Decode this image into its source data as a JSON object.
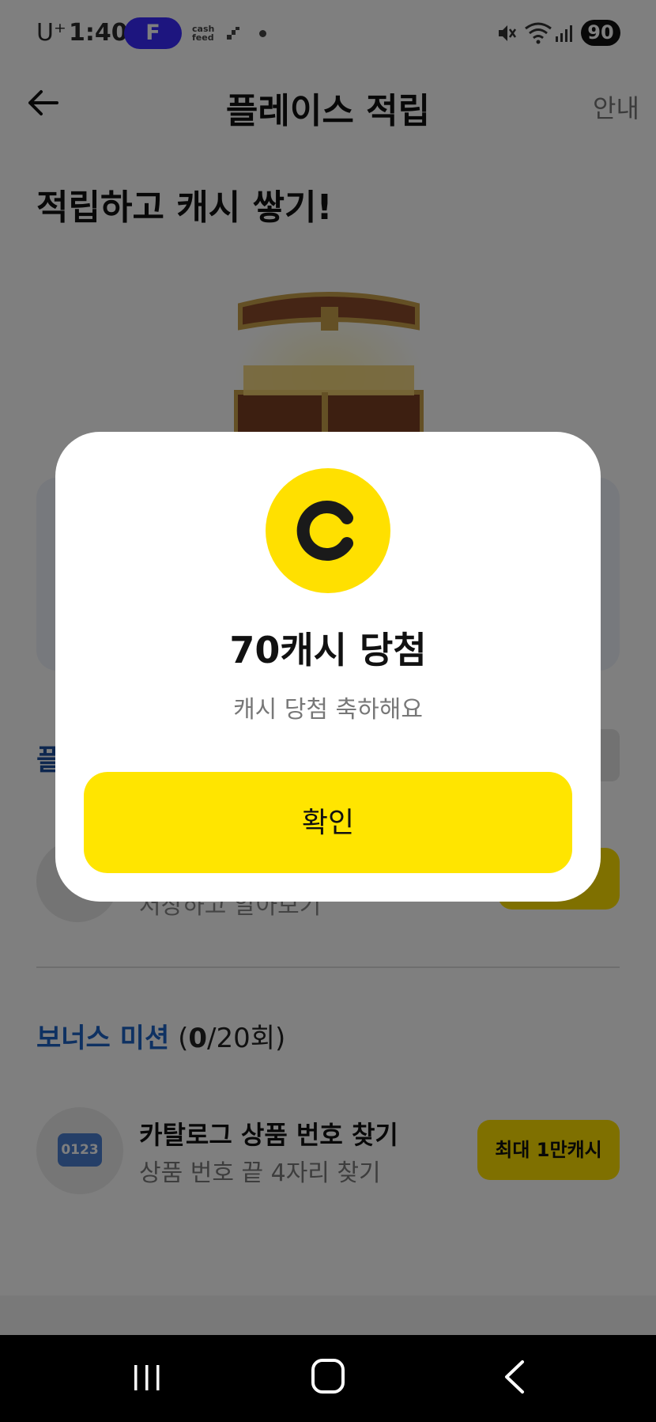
{
  "status_bar": {
    "carrier": "U⁺",
    "time": "1:40",
    "app_badge": "F",
    "cashfeed_line1": "cash",
    "cashfeed_line2": "feed",
    "battery": "90"
  },
  "header": {
    "title": "플레이스 적립",
    "guide_link": "안내"
  },
  "main": {
    "headline": "적립하고 캐시 쌓기!",
    "section1_label": "플",
    "row1_text": "저장하고 알아보기",
    "bonus": {
      "label": "보너스 미션",
      "count_prefix": "(",
      "count_done": "0",
      "count_total": "/20회)"
    },
    "mission": {
      "badge": "0123",
      "title": "카탈로그 상품 번호 찾기",
      "subtitle": "상품 번호 끝 4자리 찾기",
      "reward": "최대 1만캐시"
    }
  },
  "modal": {
    "coin_letter": "C",
    "title": "70캐시 당첨",
    "description": "캐시 당첨 축하해요",
    "confirm_label": "확인"
  },
  "colors": {
    "accent_yellow": "#ffe500",
    "accent_blue": "#1d62c5",
    "overlay": "rgba(0,0,0,0.5)"
  }
}
